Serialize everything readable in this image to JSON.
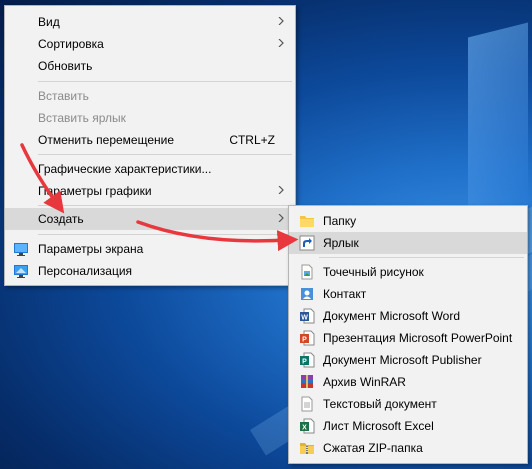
{
  "context_menu": {
    "items": [
      {
        "label": "Вид",
        "has_submenu": true
      },
      {
        "label": "Сортировка",
        "has_submenu": true
      },
      {
        "label": "Обновить"
      },
      {
        "label": "Вставить",
        "disabled": true
      },
      {
        "label": "Вставить ярлык",
        "disabled": true
      },
      {
        "label": "Отменить перемещение",
        "shortcut": "CTRL+Z"
      },
      {
        "label": "Графические характеристики..."
      },
      {
        "label": "Параметры графики",
        "has_submenu": true
      },
      {
        "label": "Создать",
        "has_submenu": true,
        "highlighted": true
      },
      {
        "label": "Параметры экрана",
        "icon": "display-settings-icon"
      },
      {
        "label": "Персонализация",
        "icon": "personalization-icon"
      }
    ]
  },
  "create_submenu": {
    "items": [
      {
        "label": "Папку",
        "icon": "folder-icon"
      },
      {
        "label": "Ярлык",
        "icon": "shortcut-icon",
        "highlighted": true
      },
      {
        "label": "Точечный рисунок",
        "icon": "bitmap-icon"
      },
      {
        "label": "Контакт",
        "icon": "contact-icon"
      },
      {
        "label": "Документ Microsoft Word",
        "icon": "word-icon"
      },
      {
        "label": "Презентация Microsoft PowerPoint",
        "icon": "powerpoint-icon"
      },
      {
        "label": "Документ Microsoft Publisher",
        "icon": "publisher-icon"
      },
      {
        "label": "Архив WinRAR",
        "icon": "winrar-icon"
      },
      {
        "label": "Текстовый документ",
        "icon": "text-document-icon"
      },
      {
        "label": "Лист Microsoft Excel",
        "icon": "excel-icon"
      },
      {
        "label": "Сжатая ZIP-папка",
        "icon": "zip-folder-icon"
      }
    ]
  },
  "colors": {
    "annotation_arrow": "#e8383d",
    "menu_background": "#f2f2f2",
    "highlight": "#d9d9d9",
    "disabled_text": "#8a8a8a"
  }
}
